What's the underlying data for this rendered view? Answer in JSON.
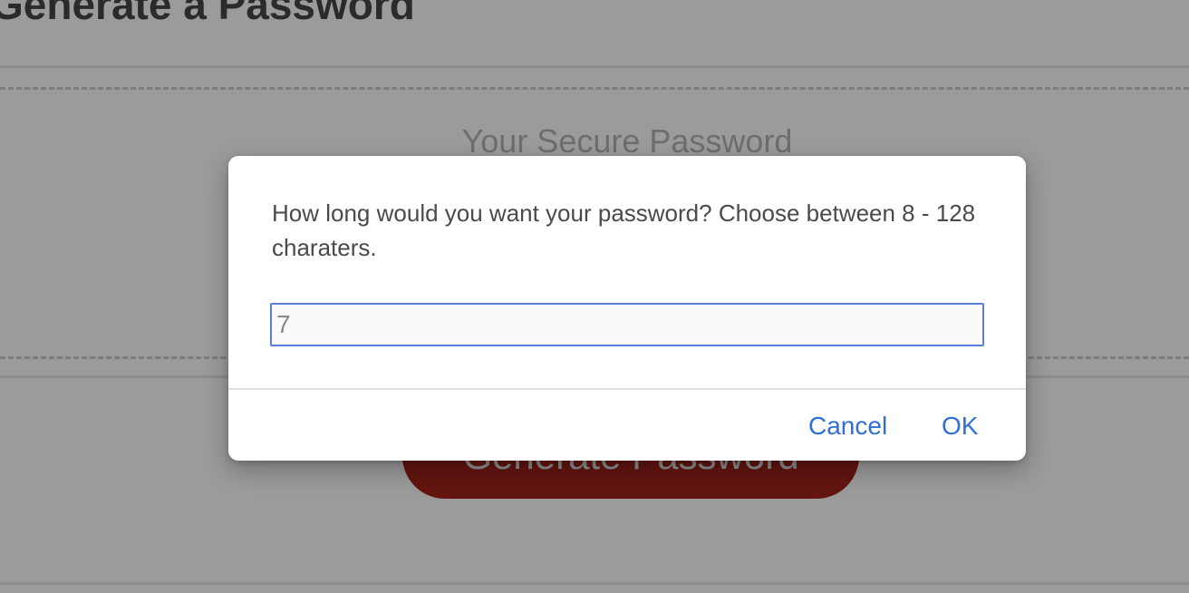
{
  "page": {
    "title": "Generate a Password",
    "card_header": "Your Secure Password",
    "generate_button_label": "Generate Password"
  },
  "dialog": {
    "message": "How long would you want your password? Choose between 8 - 128 charaters.",
    "input_value": "7",
    "cancel_label": "Cancel",
    "ok_label": "OK"
  },
  "colors": {
    "overlay": "#9b9b9b",
    "button_bg": "#641510",
    "dialog_accent": "#2f6fd8",
    "input_border": "#5b7ee3"
  }
}
